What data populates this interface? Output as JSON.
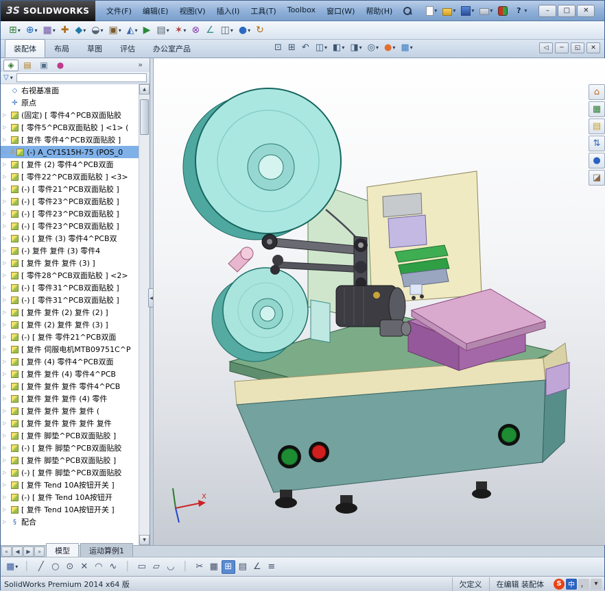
{
  "window": {
    "brand_mark": "3S",
    "brand": "SOLIDWORKS",
    "help_glyph": "?",
    "buttons": [
      {
        "name": "minimize-button",
        "g": "–"
      },
      {
        "name": "maximize-button",
        "g": "□"
      },
      {
        "name": "close-button",
        "g": "✕"
      }
    ]
  },
  "menus": [
    "文件(F)",
    "编辑(E)",
    "视图(V)",
    "插入(I)",
    "工具(T)",
    "Toolbox",
    "窗口(W)",
    "帮助(H)"
  ],
  "qat": [
    {
      "name": "new-document-icon",
      "kind": "new",
      "g": "",
      "v": "▾"
    },
    {
      "name": "open-icon",
      "kind": "open",
      "g": "",
      "v": "▾"
    },
    {
      "name": "save-icon",
      "kind": "save",
      "g": "",
      "v": "▾"
    },
    {
      "name": "print-icon",
      "kind": "print",
      "g": "",
      "v": "▾"
    },
    {
      "name": "addins-icon",
      "kind": "plug",
      "g": "",
      "v": ""
    },
    {
      "name": "help-icon",
      "kind": "help",
      "g": "?",
      "v": "▾"
    }
  ],
  "toolbar2": [
    {
      "name": "insert-component-icon",
      "g": "⊞",
      "st": "color:#2e7d32",
      "v": "▾"
    },
    {
      "name": "mate-icon",
      "g": "⊕",
      "st": "color:#1565c0",
      "v": "▾"
    },
    {
      "name": "component-pattern-icon",
      "g": "▦",
      "st": "color:#6a4fa0",
      "v": "▾"
    },
    {
      "name": "smart-fasteners-icon",
      "g": "✚",
      "st": "color:#b06a10",
      "v": ""
    },
    {
      "name": "move-component-icon",
      "g": "◆",
      "st": "color:#1f7aa8",
      "v": "▾"
    },
    {
      "name": "show-hidden-icon",
      "g": "◒",
      "st": "color:#556070",
      "v": "▾"
    },
    {
      "name": "assembly-features-icon",
      "g": "▣",
      "st": "color:#7a5a2a",
      "v": "▾"
    },
    {
      "name": "reference-geometry-icon",
      "g": "◭",
      "st": "color:#3a6ab0",
      "v": "▾"
    },
    {
      "name": "motion-study-icon",
      "g": "▶",
      "st": "color:#2a8a3a",
      "v": ""
    },
    {
      "name": "bom-icon",
      "g": "▤",
      "st": "color:#506070",
      "v": "▾"
    },
    {
      "name": "exploded-view-icon",
      "g": "✶",
      "st": "color:#b03a3a",
      "v": "▾"
    },
    {
      "name": "interference-check-icon",
      "g": "⊗",
      "st": "color:#8a3ab0",
      "v": ""
    },
    {
      "name": "measure-icon",
      "g": "∠",
      "st": "color:#3a8a8a",
      "v": ""
    },
    {
      "name": "section-icon",
      "g": "◫",
      "st": "color:#506070",
      "v": "▾"
    },
    {
      "name": "appearances-icon",
      "g": "●",
      "st": "color:#2a6ac0",
      "v": "▾"
    },
    {
      "name": "update-icon",
      "g": "↻",
      "st": "color:#b06a10",
      "v": ""
    }
  ],
  "tabs": [
    {
      "label": "装配体",
      "cls": "active"
    },
    {
      "label": "布局",
      "cls": ""
    },
    {
      "label": "草图",
      "cls": ""
    },
    {
      "label": "评估",
      "cls": ""
    },
    {
      "label": "办公室产品",
      "cls": ""
    }
  ],
  "headsup": [
    {
      "name": "zoom-fit-icon",
      "g": "⊡",
      "v": ""
    },
    {
      "name": "zoom-area-icon",
      "g": "⊞",
      "v": ""
    },
    {
      "name": "previous-view-icon",
      "g": "↶",
      "v": ""
    },
    {
      "name": "section-view-icon",
      "g": "◫",
      "v": "▾"
    },
    {
      "name": "view-orientation-icon",
      "g": "◧",
      "v": "▾"
    },
    {
      "name": "display-style-icon",
      "g": "◨",
      "v": "▾"
    },
    {
      "name": "hide-show-items-icon",
      "g": "◎",
      "v": "▾"
    },
    {
      "name": "edit-appearance-icon",
      "g": "●",
      "st": "color:#e07030",
      "v": "▾"
    },
    {
      "name": "apply-scene-icon",
      "g": "▦",
      "st": "color:#3a7ac0",
      "v": "▾"
    }
  ],
  "doc_controls": [
    {
      "name": "doc-prev-icon",
      "g": "◁"
    },
    {
      "name": "doc-minimize-icon",
      "g": "─"
    },
    {
      "name": "doc-restore-icon",
      "g": "◱"
    },
    {
      "name": "doc-close-icon",
      "g": "✕"
    }
  ],
  "panel": {
    "chevron": "»",
    "tabs": [
      {
        "name": "featuremanager-tab",
        "g": "◈",
        "st": "color:#2e7d32",
        "cls": "active"
      },
      {
        "name": "propertymanager-tab",
        "g": "▤",
        "st": "color:#b07a20",
        "cls": ""
      },
      {
        "name": "configurationmanager-tab",
        "g": "▣",
        "st": "color:#55708a",
        "cls": ""
      },
      {
        "name": "displaymanager-tab",
        "g": "●",
        "st": "color:#c03a8a",
        "cls": ""
      }
    ],
    "filter_funnel": "▽",
    "filter_caret": "▾",
    "tree": [
      {
        "cls": "plane",
        "a": "",
        "ic": "◇",
        "text": "右视基准面"
      },
      {
        "cls": "origin",
        "a": "",
        "ic": "✛",
        "text": "原点"
      },
      {
        "cls": "part",
        "a": "▷",
        "ic": "",
        "text": "(固定) [ 零件4^PCB双面贴胶"
      },
      {
        "cls": "part",
        "a": "▷",
        "ic": "",
        "text": "[ 零件5^PCB双面贴胶 ] <1> ("
      },
      {
        "cls": "part",
        "a": "▷",
        "ic": "",
        "text": "[ 复件 零件4^PCB双面贴胶 ]"
      },
      {
        "cls": "part warn sel",
        "a": "▷",
        "b": "⚠",
        "ic": "",
        "text": "(-) A_CY1S15H-75 (POS_0"
      },
      {
        "cls": "part",
        "a": "▷",
        "ic": "",
        "text": "[ 复件 (2) 零件4^PCB双面"
      },
      {
        "cls": "part",
        "a": "▷",
        "ic": "",
        "text": "[ 零件22^PCB双面贴胶 ] <3>"
      },
      {
        "cls": "part",
        "a": "▷",
        "ic": "",
        "text": "(-) [ 零件21^PCB双面贴胶 ]"
      },
      {
        "cls": "part",
        "a": "▷",
        "ic": "",
        "text": "(-) [ 零件23^PCB双面贴胶 ]"
      },
      {
        "cls": "part",
        "a": "▷",
        "ic": "",
        "text": "(-) [ 零件23^PCB双面贴胶 ]"
      },
      {
        "cls": "part",
        "a": "▷",
        "ic": "",
        "text": "(-) [ 零件23^PCB双面贴胶 ]"
      },
      {
        "cls": "part",
        "a": "▷",
        "ic": "",
        "text": "(-) [ 复件 (3) 零件4^PCB双"
      },
      {
        "cls": "part",
        "a": "▷",
        "ic": "",
        "text": "(-) 复件 复件 (3) 零件4"
      },
      {
        "cls": "part",
        "a": "▷",
        "ic": "",
        "text": "[ 复件 复件 复件 (3) ]"
      },
      {
        "cls": "part",
        "a": "▷",
        "ic": "",
        "text": "[ 零件28^PCB双面贴胶 ] <2>"
      },
      {
        "cls": "part",
        "a": "▷",
        "ic": "",
        "text": "(-) [ 零件31^PCB双面贴胶 ]"
      },
      {
        "cls": "part",
        "a": "▷",
        "ic": "",
        "text": "(-) [ 零件31^PCB双面贴胶 ]"
      },
      {
        "cls": "part",
        "a": "▷",
        "ic": "",
        "text": "[ 复件 复件 (2) 复件 (2) ]"
      },
      {
        "cls": "part",
        "a": "▷",
        "ic": "",
        "text": "[ 复件 (2) 复件 复件 (3) ]"
      },
      {
        "cls": "part",
        "a": "▷",
        "ic": "",
        "text": "(-) [ 复件 零件21^PCB双面"
      },
      {
        "cls": "part",
        "a": "▷",
        "ic": "",
        "text": "[ 复件 伺服电机MTB09751C^P"
      },
      {
        "cls": "part",
        "a": "▷",
        "ic": "",
        "text": "[ 复件 (4) 零件4^PCB双面"
      },
      {
        "cls": "part",
        "a": "▷",
        "ic": "",
        "text": "[ 复件 复件 (4) 零件4^PCB"
      },
      {
        "cls": "part",
        "a": "▷",
        "ic": "",
        "text": "[ 复件 复件 复件 零件4^PCB"
      },
      {
        "cls": "part",
        "a": "▷",
        "ic": "",
        "text": "[ 复件 复件 复件 (4) 零件"
      },
      {
        "cls": "part",
        "a": "▷",
        "ic": "",
        "text": "[ 复件 复件 复件 复件 ("
      },
      {
        "cls": "part",
        "a": "▷",
        "ic": "",
        "text": "[ 复件 复件 复件 复件 复件"
      },
      {
        "cls": "part",
        "a": "▷",
        "ic": "",
        "text": "[ 复件 脚垫^PCB双面贴胶 ]"
      },
      {
        "cls": "part",
        "a": "▷",
        "ic": "",
        "text": "(-) [ 复件 脚垫^PCB双面贴胶"
      },
      {
        "cls": "part",
        "a": "▷",
        "ic": "",
        "text": "[ 复件 脚垫^PCB双面贴胶 ]"
      },
      {
        "cls": "part",
        "a": "▷",
        "ic": "",
        "text": "(-) [ 复件 脚垫^PCB双面贴胶"
      },
      {
        "cls": "part",
        "a": "▷",
        "ic": "",
        "text": "[ 复件 Tend 10A按钮开关 ]"
      },
      {
        "cls": "part",
        "a": "▷",
        "ic": "",
        "text": "(-) [ 复件 Tend 10A按钮开"
      },
      {
        "cls": "part",
        "a": "▷",
        "ic": "",
        "text": "[ 复件 Tend 10A按钮开关 ]"
      },
      {
        "cls": "mates",
        "a": "▷",
        "ic": "§",
        "text": "配合"
      }
    ]
  },
  "viewport": {
    "triad_x": "X",
    "colors": {
      "reel_cyan": "#abe7e1",
      "deck_green": "#7cab88",
      "base_teal": "#74a29e",
      "base_cream": "#eae3ba",
      "panel_cream": "#efeac2",
      "plate_pink": "#d9aacd",
      "platform_purple": "#b27ab2",
      "motor_gray": "#3c3c42",
      "button_green": "#1d8c33",
      "button_red": "#cf1f1f"
    }
  },
  "taskpane": [
    {
      "name": "home-icon",
      "g": "⌂",
      "st": "color:#c06a20"
    },
    {
      "name": "design-library-icon",
      "g": "▦",
      "st": "color:#2e7d32"
    },
    {
      "name": "file-explorer-icon",
      "g": "▤",
      "st": "color:#c8a020"
    },
    {
      "name": "view-palette-icon",
      "g": "⇅",
      "st": "color:#2a62c0"
    },
    {
      "name": "appearances-scenes-icon",
      "g": "●",
      "st": "color:#2a62c0"
    },
    {
      "name": "custom-properties-icon",
      "g": "◪",
      "st": "color:#8a6a4a"
    }
  ],
  "bottom": {
    "nav": [
      {
        "name": "first-tab-button",
        "g": "«"
      },
      {
        "name": "prev-tab-button",
        "g": "◀"
      },
      {
        "name": "next-tab-button",
        "g": "▶"
      },
      {
        "name": "last-tab-button",
        "g": "»"
      }
    ],
    "tabs": [
      {
        "label": "模型",
        "cls": "active"
      },
      {
        "label": "运动算例1",
        "cls": ""
      }
    ]
  },
  "sketchbar": [
    {
      "name": "save-tool-icon",
      "g": "▦",
      "st": "color:#3a5aa0",
      "v": "▾"
    },
    {
      "name": "divider",
      "g": "│",
      "st": "color:#aab4c0",
      "v": ""
    },
    {
      "name": "line-tool-icon",
      "g": "╱",
      "v": ""
    },
    {
      "name": "circle-tool-icon",
      "g": "○",
      "v": ""
    },
    {
      "name": "perimeter-circle-icon",
      "g": "⊙",
      "v": ""
    },
    {
      "name": "erase-tool-icon",
      "g": "✕",
      "v": ""
    },
    {
      "name": "arc-tool-icon",
      "g": "◠",
      "v": ""
    },
    {
      "name": "spline-tool-icon",
      "g": "∿",
      "v": ""
    },
    {
      "name": "divider",
      "g": "│",
      "st": "color:#aab4c0",
      "v": ""
    },
    {
      "name": "rectangle-tool-icon",
      "g": "▭",
      "v": ""
    },
    {
      "name": "slot-tool-icon",
      "g": "▱",
      "v": ""
    },
    {
      "name": "arc3-tool-icon",
      "g": "◡",
      "v": ""
    },
    {
      "name": "divider",
      "g": "│",
      "st": "color:#aab4c0",
      "v": ""
    },
    {
      "name": "trim-tool-icon",
      "g": "✂",
      "v": ""
    },
    {
      "name": "pattern-tool-icon",
      "g": "▦",
      "v": ""
    },
    {
      "name": "grid-toggle-icon",
      "g": "⊞",
      "st": "color:#fff;background:#5a8ad0;border:1px solid #3a6ab0",
      "v": ""
    },
    {
      "name": "units-icon",
      "g": "▤",
      "v": ""
    },
    {
      "name": "angle-tool-icon",
      "g": "∠",
      "v": ""
    },
    {
      "name": "table-tool-icon",
      "g": "≡",
      "v": ""
    }
  ],
  "statusbar": {
    "app": "SolidWorks Premium 2014 x64 版",
    "state": "欠定义",
    "editing": "在编辑 装配体",
    "ime": [
      {
        "name": "ime-logo-icon",
        "g": "S",
        "st": "background:#e84315;color:#fff;border-radius:8px;font-weight:bold"
      },
      {
        "name": "ime-mode-icon",
        "g": "中",
        "st": "background:#2a62c0;color:#fff"
      },
      {
        "name": "ime-punct-icon",
        "g": "，",
        "st": "background:#c8ccd4;color:#333"
      },
      {
        "name": "ime-more-icon",
        "g": "▾",
        "st": "background:#c8ccd4;color:#333"
      }
    ]
  }
}
